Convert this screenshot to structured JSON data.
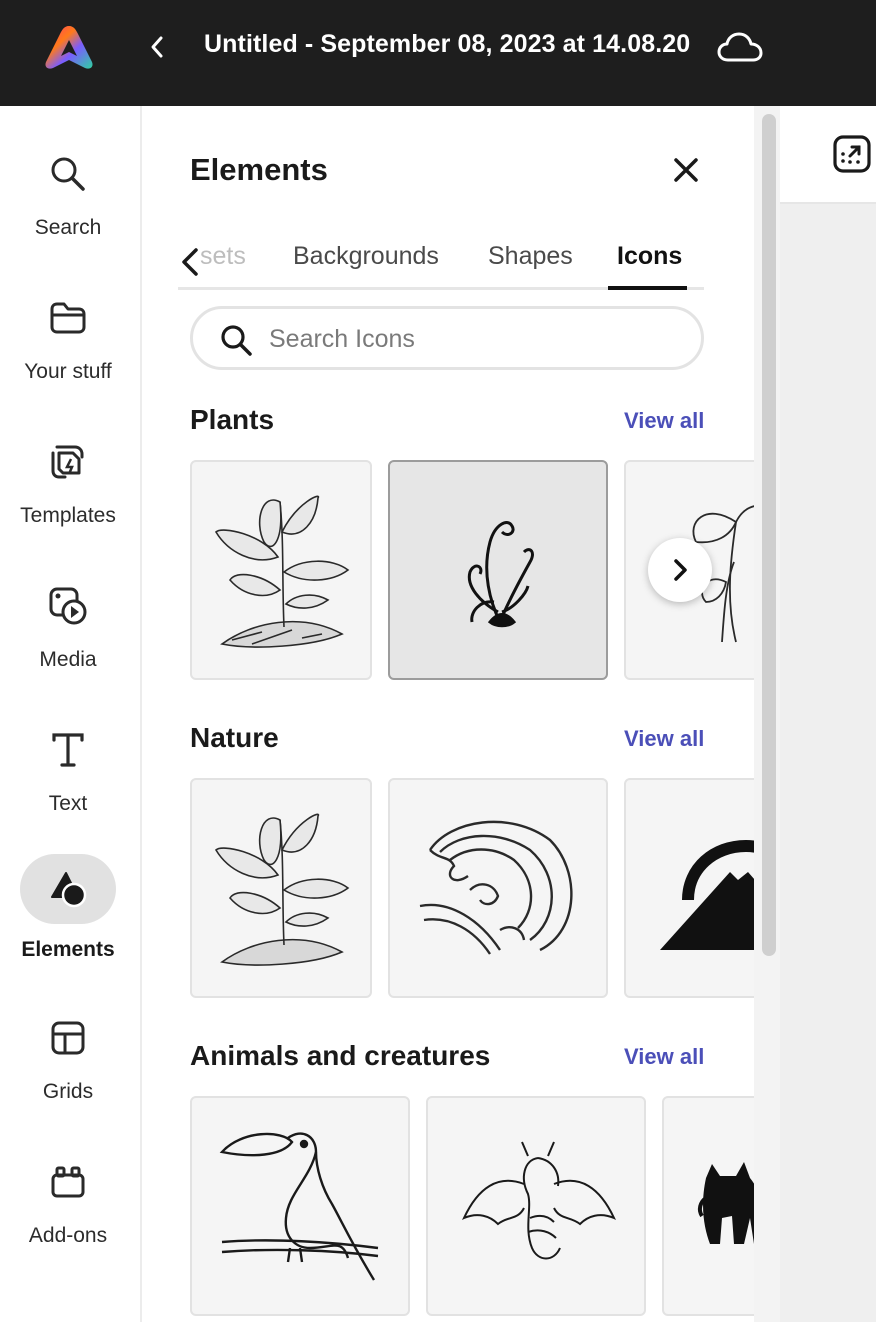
{
  "header": {
    "title": "Untitled - September 08, 2023 at 14.08.20",
    "icons": [
      "adobe-express-logo",
      "chevron-left-icon",
      "cloud-icon"
    ]
  },
  "sidebar": {
    "items": [
      {
        "label": "Search",
        "icon": "search-icon"
      },
      {
        "label": "Your stuff",
        "icon": "folder-icon"
      },
      {
        "label": "Templates",
        "icon": "templates-icon"
      },
      {
        "label": "Media",
        "icon": "media-icon"
      },
      {
        "label": "Text",
        "icon": "text-icon"
      },
      {
        "label": "Elements",
        "icon": "elements-icon",
        "active": true
      },
      {
        "label": "Grids",
        "icon": "grid-icon"
      },
      {
        "label": "Add-ons",
        "icon": "addons-icon"
      }
    ]
  },
  "panel": {
    "title": "Elements",
    "tabs": [
      {
        "label": "sets",
        "state": "faded"
      },
      {
        "label": "Backgrounds"
      },
      {
        "label": "Shapes"
      },
      {
        "label": "Icons",
        "state": "active"
      }
    ],
    "search": {
      "placeholder": "Search Icons",
      "value": ""
    },
    "view_all_label": "View all",
    "sections": [
      {
        "title": "Plants",
        "items": [
          "plant-sprout-sketch",
          "ornamental-swirl-plant",
          "ginkgo-line-plant"
        ]
      },
      {
        "title": "Nature",
        "items": [
          "plant-sprout-sketch",
          "ocean-wave",
          "mountain-sun"
        ]
      },
      {
        "title": "Animals and creatures",
        "items": [
          "toucan-on-branch",
          "dragon",
          "black-cat"
        ]
      }
    ]
  },
  "colors": {
    "topbar": "#1e1e1e",
    "accent_link": "#4b4fb8",
    "active_pill": "#e1e1e1"
  }
}
